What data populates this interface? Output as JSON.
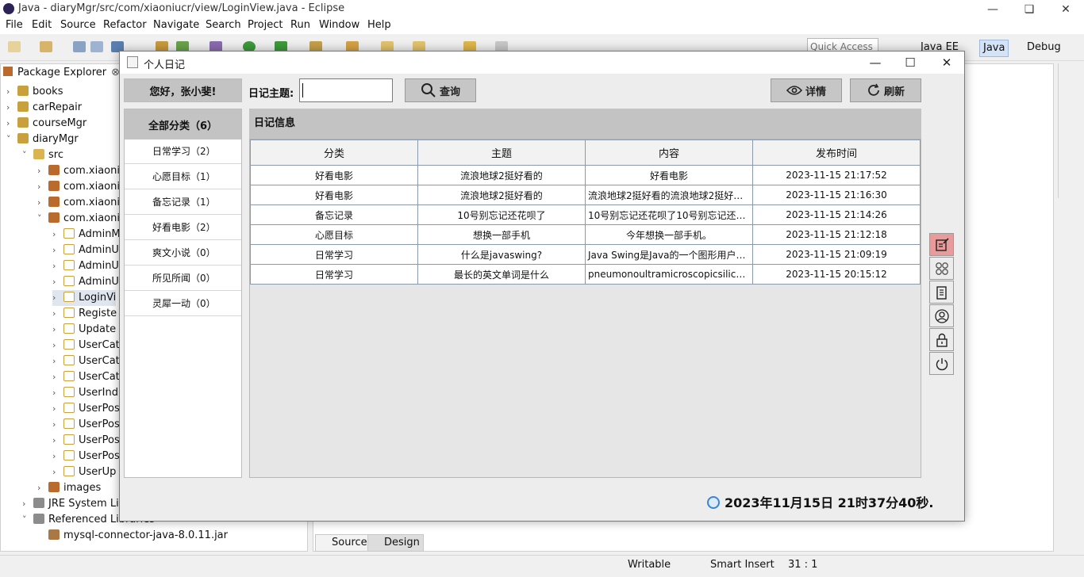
{
  "eclipse": {
    "title": "Java - diaryMgr/src/com/xiaoniucr/view/LoginView.java - Eclipse",
    "menu": [
      "File",
      "Edit",
      "Source",
      "Refactor",
      "Navigate",
      "Search",
      "Project",
      "Run",
      "Window",
      "Help"
    ],
    "quick_access": "Quick Access",
    "perspectives": [
      "Java EE",
      "Java",
      "Debug"
    ],
    "package_explorer_title": "Package Explorer",
    "tree": [
      {
        "label": "books",
        "icon": "project-icon"
      },
      {
        "label": "carRepair",
        "icon": "project-icon"
      },
      {
        "label": "courseMgr",
        "icon": "project-icon"
      },
      {
        "label": "diaryMgr",
        "icon": "project-icon"
      },
      {
        "label": "src",
        "icon": "source-folder-icon"
      },
      {
        "label": "com.xiaoni",
        "icon": "package-icon"
      },
      {
        "label": "com.xiaoni",
        "icon": "package-icon"
      },
      {
        "label": "com.xiaoni",
        "icon": "package-icon"
      },
      {
        "label": "com.xiaoni",
        "icon": "package-icon"
      },
      {
        "label": "AdminM",
        "icon": "java-file-icon"
      },
      {
        "label": "AdminU",
        "icon": "java-file-icon"
      },
      {
        "label": "AdminU",
        "icon": "java-file-icon"
      },
      {
        "label": "AdminU",
        "icon": "java-file-icon"
      },
      {
        "label": "LoginVi",
        "icon": "java-file-icon"
      },
      {
        "label": "Registe",
        "icon": "java-file-icon"
      },
      {
        "label": "Update",
        "icon": "java-file-icon"
      },
      {
        "label": "UserCat",
        "icon": "java-file-icon"
      },
      {
        "label": "UserCat",
        "icon": "java-file-icon"
      },
      {
        "label": "UserCat",
        "icon": "java-file-icon"
      },
      {
        "label": "UserInd",
        "icon": "java-file-icon"
      },
      {
        "label": "UserPos",
        "icon": "java-file-icon"
      },
      {
        "label": "UserPos",
        "icon": "java-file-icon"
      },
      {
        "label": "UserPos",
        "icon": "java-file-icon"
      },
      {
        "label": "UserPos",
        "icon": "java-file-icon"
      },
      {
        "label": "UserUp",
        "icon": "java-file-icon"
      },
      {
        "label": "images",
        "icon": "package-icon"
      },
      {
        "label": "JRE System Lib",
        "icon": "library-icon"
      },
      {
        "label": "Referenced Libraries",
        "icon": "library-icon"
      },
      {
        "label": "mysql-connector-java-8.0.11.jar",
        "icon": "jar-icon"
      }
    ],
    "editor_tabs": [
      "Source",
      "Design"
    ],
    "status": {
      "writable": "Writable",
      "insert_mode": "Smart Insert",
      "position": "31 : 1"
    }
  },
  "dialog": {
    "title": "个人日记",
    "greeting": "您好，张小斐!",
    "topic_label": "日记主题:",
    "topic_value": "",
    "search_button": "查询",
    "details_button": "详情",
    "refresh_button": "刷新",
    "categories_all": "全部分类（6）",
    "categories": [
      "日常学习（2）",
      "心愿目标（1）",
      "备忘记录（1）",
      "好看电影（2）",
      "爽文小说（0）",
      "所见所闻（0）",
      "灵犀一动（0）"
    ],
    "table_title": "日记信息",
    "columns": [
      "分类",
      "主题",
      "内容",
      "发布时间"
    ],
    "rows": [
      [
        "好看电影",
        "流浪地球2挺好看的",
        "好看电影",
        "2023-11-15 21:17:52"
      ],
      [
        "好看电影",
        "流浪地球2挺好看的",
        "流浪地球2挺好看的流浪地球2挺好看...",
        "2023-11-15 21:16:30"
      ],
      [
        "备忘记录",
        "10号别忘记还花呗了",
        "10号别忘记还花呗了10号别忘记还花...",
        "2023-11-15 21:14:26"
      ],
      [
        "心愿目标",
        "想换一部手机",
        "今年想换一部手机。",
        "2023-11-15 21:12:18"
      ],
      [
        "日常学习",
        "什么是javaswing?",
        "Java Swing是Java的一个图形用户界...",
        "2023-11-15 21:09:19"
      ],
      [
        "日常学习",
        "最长的英文单词是什么",
        "pneumonoultramicroscopicsilicovol...",
        "2023-11-15 20:15:12"
      ]
    ],
    "side_buttons": [
      "edit-note-icon",
      "grid-icon",
      "document-icon",
      "user-icon",
      "lock-icon",
      "power-icon"
    ],
    "clock": "2023年11月15日 21时37分40秒."
  }
}
